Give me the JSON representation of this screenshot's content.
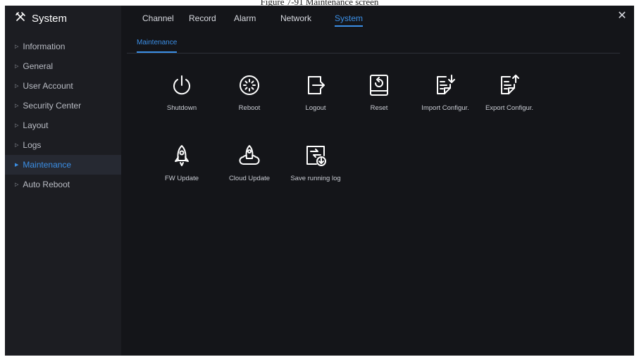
{
  "caption": "Figure 7-91 Maintenance screen",
  "app": {
    "title": "System",
    "close_label": "✕"
  },
  "top_tabs": [
    {
      "label": "Channel",
      "active": false
    },
    {
      "label": "Record",
      "active": false
    },
    {
      "label": "Alarm",
      "active": false
    },
    {
      "label": "Network",
      "active": false
    },
    {
      "label": "System",
      "active": true
    }
  ],
  "sidebar": {
    "items": [
      {
        "label": "Information",
        "active": false
      },
      {
        "label": "General",
        "active": false
      },
      {
        "label": "User Account",
        "active": false
      },
      {
        "label": "Security Center",
        "active": false
      },
      {
        "label": "Layout",
        "active": false
      },
      {
        "label": "Logs",
        "active": false
      },
      {
        "label": "Maintenance",
        "active": true
      },
      {
        "label": "Auto Reboot",
        "active": false
      }
    ]
  },
  "subtab": {
    "label": "Maintenance"
  },
  "tiles": [
    {
      "label": "Shutdown",
      "icon": "power-icon"
    },
    {
      "label": "Reboot",
      "icon": "reboot-icon"
    },
    {
      "label": "Logout",
      "icon": "logout-icon"
    },
    {
      "label": "Reset",
      "icon": "reset-icon"
    },
    {
      "label": "Import Configur.",
      "icon": "import-config-icon"
    },
    {
      "label": "Export Configur.",
      "icon": "export-config-icon"
    },
    {
      "label": "FW Update",
      "icon": "rocket-icon"
    },
    {
      "label": "Cloud Update",
      "icon": "cloud-rocket-icon"
    },
    {
      "label": "Save running log",
      "icon": "save-log-icon"
    }
  ],
  "colors": {
    "accent": "#3b8fe6",
    "background": "#141519",
    "sidebar": "#1c1d22"
  }
}
